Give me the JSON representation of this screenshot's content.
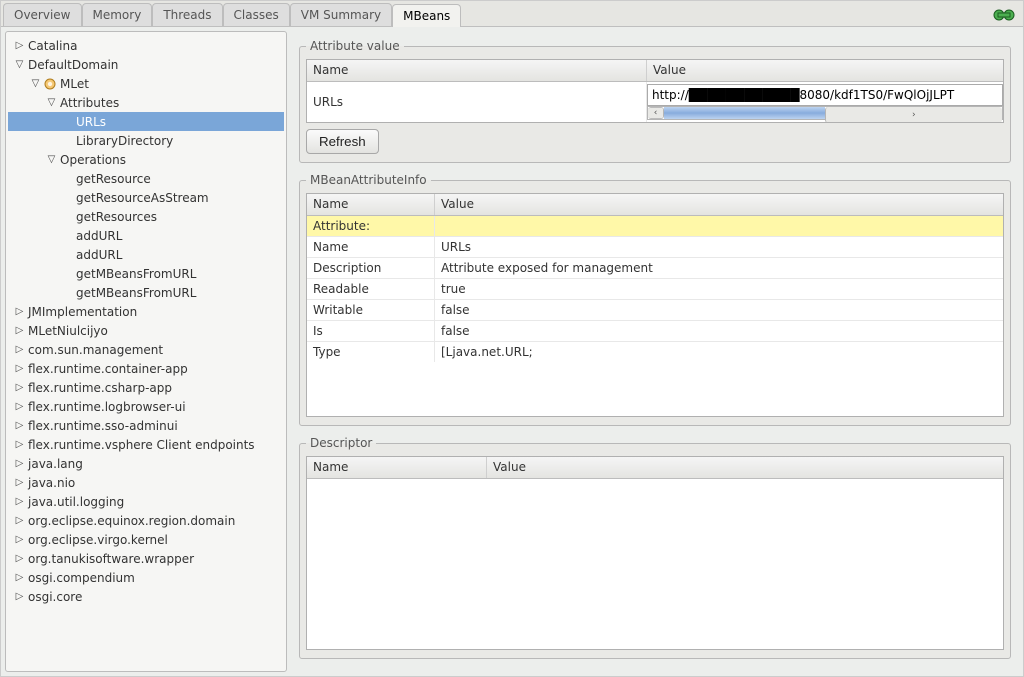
{
  "tabs": [
    "Overview",
    "Memory",
    "Threads",
    "Classes",
    "VM Summary",
    "MBeans"
  ],
  "active_tab": "MBeans",
  "tree": [
    {
      "depth": 0,
      "arrow": "closed",
      "label": "Catalina"
    },
    {
      "depth": 0,
      "arrow": "open",
      "label": "DefaultDomain"
    },
    {
      "depth": 1,
      "arrow": "open",
      "icon": true,
      "label": "MLet"
    },
    {
      "depth": 2,
      "arrow": "open",
      "label": "Attributes"
    },
    {
      "depth": 3,
      "arrow": "none",
      "label": "URLs",
      "selected": true
    },
    {
      "depth": 3,
      "arrow": "none",
      "label": "LibraryDirectory"
    },
    {
      "depth": 2,
      "arrow": "open",
      "label": "Operations"
    },
    {
      "depth": 3,
      "arrow": "none",
      "label": "getResource"
    },
    {
      "depth": 3,
      "arrow": "none",
      "label": "getResourceAsStream"
    },
    {
      "depth": 3,
      "arrow": "none",
      "label": "getResources"
    },
    {
      "depth": 3,
      "arrow": "none",
      "label": "addURL"
    },
    {
      "depth": 3,
      "arrow": "none",
      "label": "addURL"
    },
    {
      "depth": 3,
      "arrow": "none",
      "label": "getMBeansFromURL"
    },
    {
      "depth": 3,
      "arrow": "none",
      "label": "getMBeansFromURL"
    },
    {
      "depth": 0,
      "arrow": "closed",
      "label": "JMImplementation"
    },
    {
      "depth": 0,
      "arrow": "closed",
      "label": "MLetNiulcijyo"
    },
    {
      "depth": 0,
      "arrow": "closed",
      "label": "com.sun.management"
    },
    {
      "depth": 0,
      "arrow": "closed",
      "label": "flex.runtime.container-app"
    },
    {
      "depth": 0,
      "arrow": "closed",
      "label": "flex.runtime.csharp-app"
    },
    {
      "depth": 0,
      "arrow": "closed",
      "label": "flex.runtime.logbrowser-ui"
    },
    {
      "depth": 0,
      "arrow": "closed",
      "label": "flex.runtime.sso-adminui"
    },
    {
      "depth": 0,
      "arrow": "closed",
      "label": "flex.runtime.vsphere Client endpoints"
    },
    {
      "depth": 0,
      "arrow": "closed",
      "label": "java.lang"
    },
    {
      "depth": 0,
      "arrow": "closed",
      "label": "java.nio"
    },
    {
      "depth": 0,
      "arrow": "closed",
      "label": "java.util.logging"
    },
    {
      "depth": 0,
      "arrow": "closed",
      "label": "org.eclipse.equinox.region.domain"
    },
    {
      "depth": 0,
      "arrow": "closed",
      "label": "org.eclipse.virgo.kernel"
    },
    {
      "depth": 0,
      "arrow": "closed",
      "label": "org.tanukisoftware.wrapper"
    },
    {
      "depth": 0,
      "arrow": "closed",
      "label": "osgi.compendium"
    },
    {
      "depth": 0,
      "arrow": "closed",
      "label": "osgi.core"
    }
  ],
  "attr_value": {
    "legend": "Attribute value",
    "col_name": "Name",
    "col_value": "Value",
    "row_name": "URLs",
    "url_prefix": "http://",
    "url_suffix": "8080/kdf1TS0/FwQlOjJLPT",
    "refresh": "Refresh"
  },
  "attr_info": {
    "legend": "MBeanAttributeInfo",
    "col_name": "Name",
    "col_value": "Value",
    "rows": [
      {
        "n": "Attribute:",
        "v": "",
        "hl": true
      },
      {
        "n": "Name",
        "v": "URLs"
      },
      {
        "n": "Description",
        "v": "Attribute exposed for management"
      },
      {
        "n": "Readable",
        "v": "true"
      },
      {
        "n": "Writable",
        "v": "false"
      },
      {
        "n": "Is",
        "v": "false"
      },
      {
        "n": "Type",
        "v": "[Ljava.net.URL;"
      }
    ]
  },
  "descriptor": {
    "legend": "Descriptor",
    "col_name": "Name",
    "col_value": "Value"
  }
}
